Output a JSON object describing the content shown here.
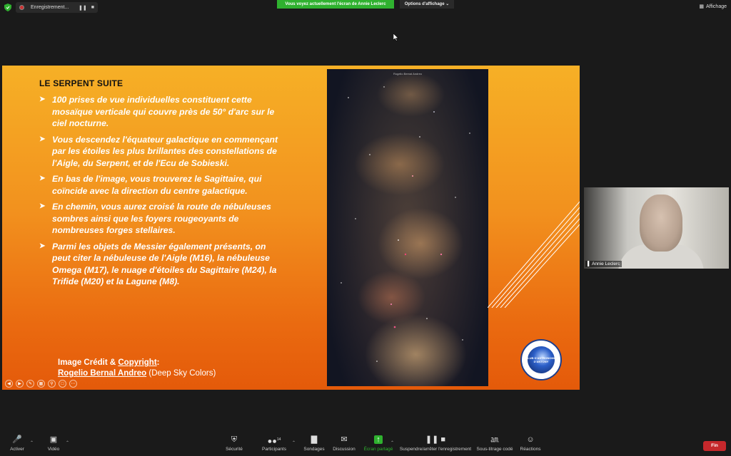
{
  "top": {
    "recording_label": "Enregistrement...",
    "share_banner": "Vous voyez actuellement l'écran de Annie Leclerc",
    "view_options": "Options d'affichage",
    "view_label": "Affichage"
  },
  "slide": {
    "title": "LE SERPENT SUITE",
    "bullets": [
      "100 prises de vue individuelles constituent cette mosaïque verticale qui couvre près de 50° d'arc sur le ciel nocturne.",
      "Vous descendez l'équateur galactique en commençant par les étoiles les plus brillantes des constellations de l'Aigle, du Serpent, et de l'Ecu de Sobieski.",
      "En bas de l'image, vous trouverez le Sagittaire, qui coïncide avec la direction du centre galactique.",
      "En chemin, vous aurez croisé la route de nébuleuses sombres ainsi que les foyers rougeoyants de nombreuses forges stellaires.",
      "Parmi les objets de Messier également présents, on peut citer la nébuleuse de l'Aigle (M16), la nébuleuse Omega (M17), le nuage d'étoiles du Sagittaire (M24), la Trifide (M20) et la Lagune (M8)."
    ],
    "credit_prefix": "Image Crédit & ",
    "credit_copyright": "Copyright",
    "credit_colon": ":",
    "credit_author": "Rogelio Bernal Andreo",
    "credit_source": " (Deep Sky Colors)",
    "photo_caption": "Rogelio Bernal Andreo",
    "logo_text": "CLUB D'ASTRONOMIE D'ANTONY"
  },
  "participant": {
    "name": "Annie Leclerc"
  },
  "toolbar": {
    "mute": "Activer",
    "video": "Vidéo",
    "security": "Sécurité",
    "participants": "Participants",
    "participants_count": "14",
    "polls": "Sondages",
    "chat": "Discussion",
    "share": "Écran partagé",
    "record": "Suspendre/arrêter l'enregistrement",
    "captions": "Sous-titrage codé",
    "reactions": "Réactions",
    "end": "Fin"
  },
  "colors": {
    "share_green": "#2fb12f",
    "end_red": "#c5282c",
    "slide_orange": "#f2911e"
  }
}
